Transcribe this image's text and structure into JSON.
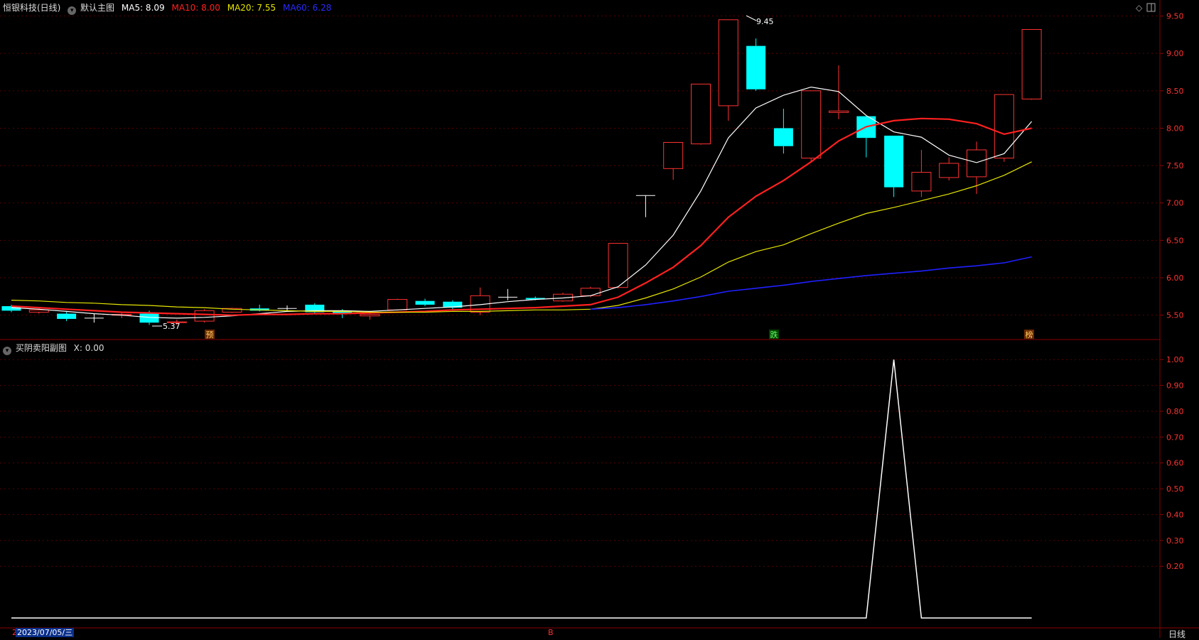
{
  "header": {
    "stock_title": "恒银科技(日线)",
    "main_chart_name": "默认主图",
    "ma5_label": "MA5: 8.09",
    "ma10_label": "MA10: 8.00",
    "ma20_label": "MA20: 7.55",
    "ma60_label": "MA60: 6.28"
  },
  "sub_header": {
    "indicator_name": "买阴卖阳副图",
    "x_label": "X: 0.00"
  },
  "footer": {
    "date_label": "2023/07/05/三",
    "period_button": "日线",
    "mid_marker": "B",
    "left_marker": "2"
  },
  "colors": {
    "up": "#ff3232",
    "down": "#00ffff",
    "ma5": "#ffffff",
    "ma10": "#ff2020",
    "ma20": "#e6e600",
    "ma60": "#2020ff",
    "axis": "#8b0000"
  },
  "chart_data": [
    {
      "type": "candlestick",
      "ylim": [
        5.25,
        9.6
      ],
      "y_ticks": [
        "9.50",
        "9.00",
        "8.50",
        "8.00",
        "7.50",
        "7.00",
        "6.50",
        "6.00",
        "5.50"
      ],
      "annotations": {
        "high_label": "9.45",
        "low_label": "5.37"
      },
      "event_markers": [
        "预",
        "跌",
        "榜"
      ],
      "candles": [
        {
          "o": 5.62,
          "h": 5.64,
          "l": 5.54,
          "c": 5.56
        },
        {
          "o": 5.54,
          "h": 5.6,
          "l": 5.52,
          "c": 5.57
        },
        {
          "o": 5.52,
          "h": 5.55,
          "l": 5.42,
          "c": 5.45
        },
        {
          "o": 5.46,
          "h": 5.52,
          "l": 5.4,
          "c": 5.46
        },
        {
          "o": 5.5,
          "h": 5.53,
          "l": 5.46,
          "c": 5.51
        },
        {
          "o": 5.52,
          "h": 5.56,
          "l": 5.37,
          "c": 5.4
        },
        {
          "o": 5.4,
          "h": 5.44,
          "l": 5.37,
          "c": 5.41
        },
        {
          "o": 5.42,
          "h": 5.58,
          "l": 5.4,
          "c": 5.56
        },
        {
          "o": 5.54,
          "h": 5.6,
          "l": 5.53,
          "c": 5.59
        },
        {
          "o": 5.59,
          "h": 5.64,
          "l": 5.55,
          "c": 5.56
        },
        {
          "o": 5.59,
          "h": 5.63,
          "l": 5.56,
          "c": 5.59
        },
        {
          "o": 5.64,
          "h": 5.66,
          "l": 5.51,
          "c": 5.54
        },
        {
          "o": 5.55,
          "h": 5.58,
          "l": 5.46,
          "c": 5.52
        },
        {
          "o": 5.49,
          "h": 5.53,
          "l": 5.44,
          "c": 5.51
        },
        {
          "o": 5.57,
          "h": 5.72,
          "l": 5.56,
          "c": 5.71
        },
        {
          "o": 5.69,
          "h": 5.72,
          "l": 5.62,
          "c": 5.64
        },
        {
          "o": 5.68,
          "h": 5.7,
          "l": 5.58,
          "c": 5.6
        },
        {
          "o": 5.54,
          "h": 5.87,
          "l": 5.5,
          "c": 5.76
        },
        {
          "o": 5.74,
          "h": 5.85,
          "l": 5.7,
          "c": 5.74
        },
        {
          "o": 5.73,
          "h": 5.75,
          "l": 5.7,
          "c": 5.71
        },
        {
          "o": 5.69,
          "h": 5.8,
          "l": 5.68,
          "c": 5.78
        },
        {
          "o": 5.76,
          "h": 5.88,
          "l": 5.74,
          "c": 5.86
        },
        {
          "o": 5.87,
          "h": 6.46,
          "l": 5.86,
          "c": 6.46
        },
        {
          "o": 7.1,
          "h": 7.1,
          "l": 6.81,
          "c": 7.1
        },
        {
          "o": 7.46,
          "h": 7.81,
          "l": 7.31,
          "c": 7.81
        },
        {
          "o": 7.79,
          "h": 8.59,
          "l": 7.78,
          "c": 8.59
        },
        {
          "o": 8.3,
          "h": 9.45,
          "l": 8.1,
          "c": 9.45
        },
        {
          "o": 9.1,
          "h": 9.2,
          "l": 8.5,
          "c": 8.52
        },
        {
          "o": 8.0,
          "h": 8.26,
          "l": 7.66,
          "c": 7.76
        },
        {
          "o": 7.6,
          "h": 8.5,
          "l": 7.56,
          "c": 8.5
        },
        {
          "o": 8.21,
          "h": 8.84,
          "l": 8.12,
          "c": 8.23
        },
        {
          "o": 8.16,
          "h": 8.16,
          "l": 7.61,
          "c": 7.87
        },
        {
          "o": 7.9,
          "h": 7.9,
          "l": 7.08,
          "c": 7.21
        },
        {
          "o": 7.16,
          "h": 7.71,
          "l": 7.08,
          "c": 7.41
        },
        {
          "o": 7.34,
          "h": 7.61,
          "l": 7.3,
          "c": 7.53
        },
        {
          "o": 7.35,
          "h": 7.82,
          "l": 7.12,
          "c": 7.71
        },
        {
          "o": 7.6,
          "h": 8.45,
          "l": 7.55,
          "c": 8.45
        },
        {
          "o": 8.39,
          "h": 9.32,
          "l": 8.38,
          "c": 9.32
        }
      ],
      "series": [
        {
          "name": "MA5",
          "values": [
            5.6,
            5.58,
            5.55,
            5.52,
            5.5,
            5.47,
            5.46,
            5.47,
            5.49,
            5.52,
            5.55,
            5.56,
            5.56,
            5.55,
            5.57,
            5.59,
            5.61,
            5.64,
            5.68,
            5.71,
            5.73,
            5.76,
            5.88,
            6.17,
            6.57,
            7.16,
            7.87,
            8.27,
            8.44,
            8.55,
            8.49,
            8.17,
            7.95,
            7.88,
            7.64,
            7.54,
            7.66,
            8.09
          ]
        },
        {
          "name": "MA10",
          "values": [
            5.62,
            5.6,
            5.58,
            5.56,
            5.54,
            5.53,
            5.52,
            5.51,
            5.5,
            5.51,
            5.51,
            5.52,
            5.52,
            5.53,
            5.54,
            5.55,
            5.57,
            5.58,
            5.59,
            5.6,
            5.62,
            5.64,
            5.74,
            5.93,
            6.14,
            6.43,
            6.81,
            7.09,
            7.3,
            7.55,
            7.83,
            8.02,
            8.1,
            8.13,
            8.12,
            8.06,
            7.92,
            8.0
          ]
        },
        {
          "name": "MA20",
          "values": [
            5.7,
            5.69,
            5.67,
            5.66,
            5.64,
            5.63,
            5.61,
            5.6,
            5.58,
            5.57,
            5.56,
            5.55,
            5.55,
            5.54,
            5.54,
            5.54,
            5.55,
            5.55,
            5.56,
            5.57,
            5.57,
            5.58,
            5.63,
            5.73,
            5.85,
            6.01,
            6.21,
            6.35,
            6.44,
            6.59,
            6.73,
            6.86,
            6.94,
            7.03,
            7.12,
            7.23,
            7.37,
            7.55
          ]
        },
        {
          "name": "MA60",
          "values": [
            null,
            null,
            null,
            null,
            null,
            null,
            null,
            null,
            null,
            null,
            null,
            null,
            null,
            null,
            null,
            null,
            null,
            null,
            null,
            null,
            null,
            5.58,
            5.6,
            5.64,
            5.69,
            5.75,
            5.82,
            5.86,
            5.9,
            5.95,
            5.99,
            6.03,
            6.06,
            6.09,
            6.13,
            6.16,
            6.2,
            6.28
          ]
        }
      ]
    },
    {
      "type": "line",
      "ylim": [
        0,
        1.05
      ],
      "y_ticks": [
        "1.00",
        "0.90",
        "0.80",
        "0.70",
        "0.60",
        "0.50",
        "0.40",
        "0.30",
        "0.20"
      ],
      "series": [
        {
          "name": "X",
          "values": [
            0,
            0,
            0,
            0,
            0,
            0,
            0,
            0,
            0,
            0,
            0,
            0,
            0,
            0,
            0,
            0,
            0,
            0,
            0,
            0,
            0,
            0,
            0,
            0,
            0,
            0,
            0,
            0,
            0,
            0,
            0,
            0,
            1,
            0,
            0,
            0,
            0,
            0
          ]
        }
      ]
    }
  ]
}
